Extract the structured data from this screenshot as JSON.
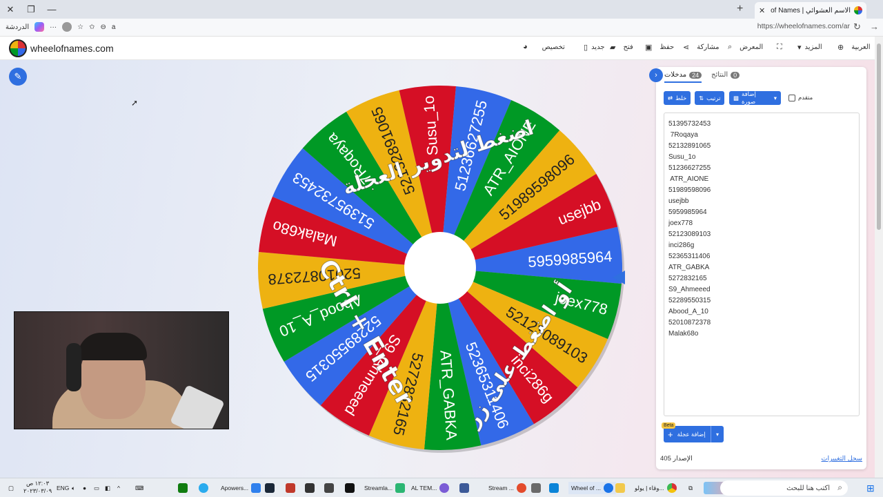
{
  "browser": {
    "tab_title": "الاسم العشوائي | Wheel of Names",
    "url": "https://wheelofnames.com/ar",
    "left_label": "الدردشة"
  },
  "header": {
    "brand": "wheelofnames.com",
    "nav": [
      {
        "label": "تخصيص",
        "icon": "palette-icon"
      },
      {
        "label": "جديد",
        "icon": "new-file-icon"
      },
      {
        "label": "فتح",
        "icon": "folder-icon"
      },
      {
        "label": "حفظ",
        "icon": "save-icon"
      },
      {
        "label": "مشاركة",
        "icon": "share-icon"
      },
      {
        "label": "المعرض",
        "icon": "search-icon"
      },
      {
        "label": "",
        "icon": "fullscreen-icon"
      },
      {
        "label": "المزيد",
        "icon": "chevron-down-icon"
      },
      {
        "label": "العربية",
        "icon": "globe-icon"
      }
    ]
  },
  "wheel": {
    "colors": [
      "#3369e8",
      "#009925",
      "#eeb211",
      "#d50f25"
    ],
    "segments": [
      "5959985964",
      "joex778",
      "52123089103",
      "inci286g",
      "52365311406",
      "ATR_GABKA",
      "5272832165",
      "S9_Ahmeeed",
      "52289550315",
      "Abood_A_10",
      "52010872378",
      "Malak68o",
      "51395732453",
      "7Roqaya",
      "52132891065",
      "Susu_1o",
      "51236627255",
      "ATR_AIONE",
      "51989598096",
      "usejbb"
    ],
    "overlay_top": "اضغط لتدوير العجلة",
    "overlay_left": "Ctrl + Enter",
    "overlay_bottom": "أو اضغط على زر"
  },
  "panel": {
    "tab_entries": "مدخلات",
    "tab_entries_count": "24",
    "tab_results": "النتائج",
    "tab_results_count": "0",
    "shuffle_label": "خلط",
    "sort_label": "ترتيب",
    "add_image_label": "إضافة صورة",
    "advanced_label": "متقدم",
    "entries": [
      "51395732453",
      " 7Roqaya",
      "52132891065",
      "Susu_1o",
      "51236627255",
      " ATR_AIONE",
      "51989598096",
      "usejbb",
      "5959985964",
      "joex778",
      "52123089103",
      "inci286g",
      "52365311406",
      "ATR_GABKA",
      "5272832165",
      "S9_Ahmeeed",
      "52289550315",
      "Abood_A_10",
      "52010872378",
      "Malak68o"
    ],
    "beta": "Beta",
    "add_wheel_label": "إضافة عجلة",
    "version": "الإصدار 405",
    "changelog": "سجل التغييرات"
  },
  "taskbar": {
    "search_placeholder": "اكتب هنا للبحث",
    "lang": "ENG",
    "time": "١٢:٠٣ ص",
    "date": "٢٠٢٣/٠٣/٠٩",
    "apps": [
      {
        "label": "وقاء | يولو...",
        "color": "#f2c94c"
      },
      {
        "label": "Wheel of ...",
        "color": "#1a73e8"
      },
      {
        "label": "Stream ...",
        "color": "#e34b2c"
      },
      {
        "label": "AL TEM...",
        "color": "#7b5cd6"
      },
      {
        "label": "Streamla...",
        "color": "#2bb673"
      },
      {
        "label": "Apowers...",
        "color": "#2f80ed"
      }
    ]
  }
}
